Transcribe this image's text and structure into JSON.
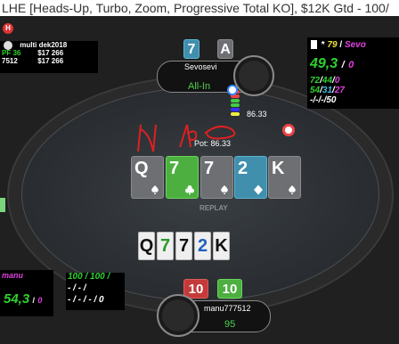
{
  "window": {
    "title": "LHE [Heads-Up, Turbo, Zoom, Progressive Total KO], $12K Gtd - 100/"
  },
  "icons": {
    "header_badge": "H"
  },
  "hud_top_left": {
    "name": "multi dek2018",
    "prefix": "PF 36",
    "stacks": [
      "$17 266",
      "$17 266"
    ],
    "value": "7512"
  },
  "hud_top_right": {
    "header_num": "79",
    "header_name": "Sevo",
    "big_value": "49,3",
    "big_suffix": "0",
    "stats_row1": [
      "72",
      "44",
      "0"
    ],
    "stats_row2": [
      "54",
      "31",
      "27"
    ],
    "stats_row3": [
      "-",
      "-",
      "-",
      "50"
    ]
  },
  "opponent": {
    "name": "Sevosevi",
    "action": "All-In",
    "hole_cards": [
      "7",
      "A"
    ],
    "bet": "86.33"
  },
  "pot": {
    "label": "Pot: 86.33"
  },
  "board": {
    "cards": [
      "Q",
      "7",
      "7",
      "2",
      "K"
    ],
    "replay_label": "REPLAY"
  },
  "mini_board": [
    "Q",
    "7",
    "7",
    "2",
    "K"
  ],
  "hero": {
    "name": "manu777512",
    "stack": "95",
    "hole_cards": [
      "10",
      "10"
    ]
  },
  "hud_bottom_left": {
    "name": "manu",
    "value": "54,3",
    "suffix": "0"
  },
  "hud_bottom_mid": {
    "row1": "100 / 100 /",
    "row2": "- / - /",
    "row3": "- / - / - / 0"
  },
  "colors": {
    "green_card": "#4caf3f",
    "grey_card": "#6d6f72",
    "blue_card": "#3f8fad",
    "red_card": "#c43a3a",
    "hud_green": "#2fd12f",
    "hud_yellow": "#f0e040",
    "hud_magenta": "#e040e0"
  }
}
